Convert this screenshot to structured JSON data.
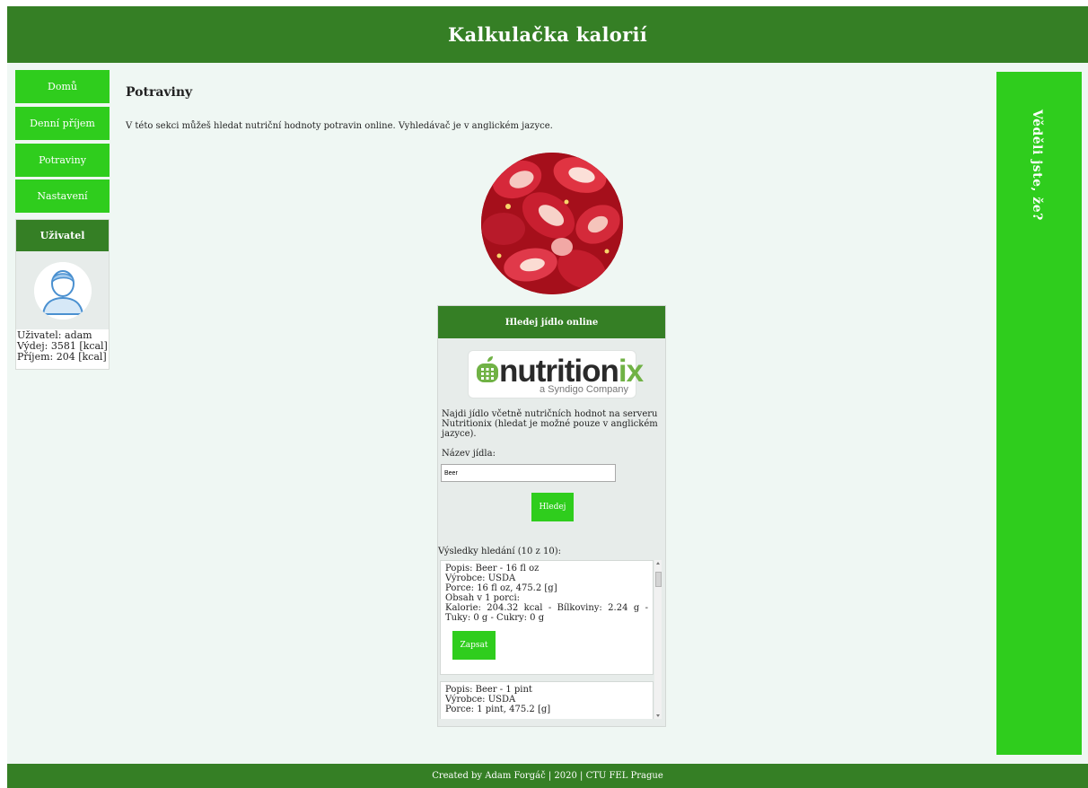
{
  "header": {
    "title": "Kalkulačka kalorií"
  },
  "nav": [
    {
      "label": "Domů"
    },
    {
      "label": "Denní příjem"
    },
    {
      "label": "Potraviny"
    },
    {
      "label": "Nastavení"
    }
  ],
  "user": {
    "title": "Uživatel",
    "name_line": "Uživatel: adam",
    "expense_line": "Výdej: 3581 [kcal]",
    "intake_line": "Příjem: 204 [kcal]"
  },
  "main": {
    "title": "Potraviny",
    "intro": "V této sekci můžeš hledat nutriční hodnoty potravin online. Vyhledávač je v anglickém jazyce."
  },
  "search": {
    "heading": "Hledej jídlo online",
    "logo_main": "nutrition",
    "logo_accent": "ix",
    "logo_sub": "a Syndigo Company",
    "description": "Najdi jídlo včetně nutričních hodnot na serveru Nutritionix (hledat je možné pouze v anglickém jazyce).",
    "input_label": "Název jídla:",
    "input_value": "Beer",
    "button_label": "Hledej",
    "results_label": "Výsledky hledání (10 z 10):"
  },
  "results": [
    {
      "desc": "Popis: Beer - 16 fl oz",
      "maker": "Výrobce: USDA",
      "portion": "Porce: 16 fl oz, 475.2 [g]",
      "content_label": "Obsah v 1 porci:",
      "nutrients": "Kalorie: 204.32 kcal - Bílkoviny: 2.24 g - Tuky: 0 g - Cukry: 0 g",
      "button": "Zapsat"
    },
    {
      "desc": "Popis: Beer - 1 pint",
      "maker": "Výrobce: USDA",
      "portion": "Porce: 1 pint, 475.2 [g]"
    }
  ],
  "tip": {
    "title": "Věděli jste, že?"
  },
  "footer": {
    "text": "Created by Adam Forgáč | 2020 | CTU FEL Prague"
  },
  "colors": {
    "dark_green": "#357f25",
    "bright_green": "#2fcd1d",
    "page_bg": "#eff7f3"
  }
}
